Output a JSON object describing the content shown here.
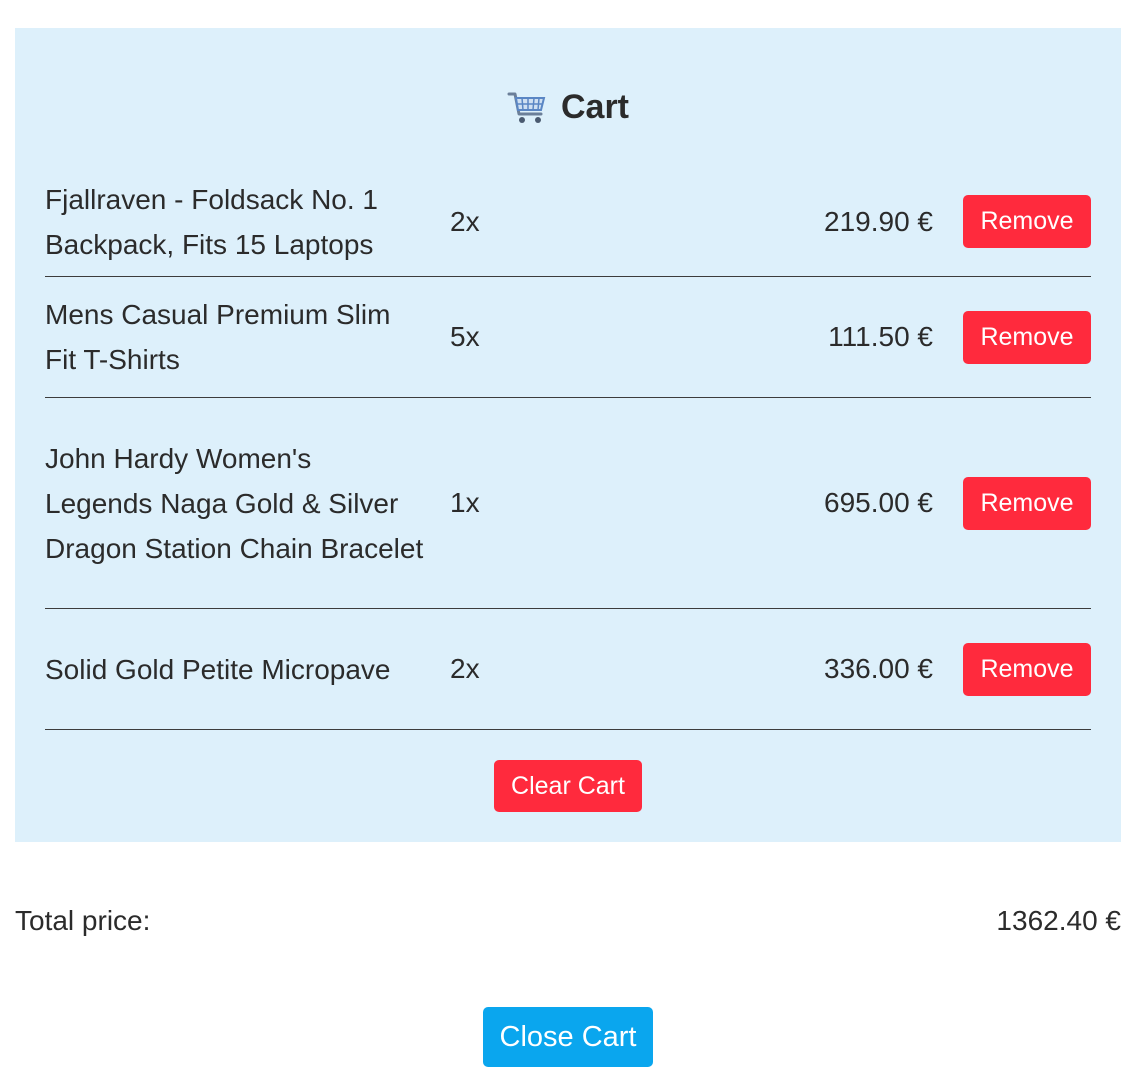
{
  "cart": {
    "icon": "shopping-cart-icon",
    "title": "Cart",
    "items": [
      {
        "name": "Fjallraven - Foldsack No. 1 Backpack, Fits 15 Laptops",
        "qty": "2x",
        "price": "219.90 €",
        "remove_label": "Remove"
      },
      {
        "name": "Mens Casual Premium Slim Fit T-Shirts",
        "qty": "5x",
        "price": "111.50 €",
        "remove_label": "Remove"
      },
      {
        "name": "John Hardy Women's Legends Naga Gold & Silver Dragon Station Chain Bracelet",
        "qty": "1x",
        "price": "695.00 €",
        "remove_label": "Remove"
      },
      {
        "name": "Solid Gold Petite Micropave",
        "qty": "2x",
        "price": "336.00 €",
        "remove_label": "Remove"
      }
    ],
    "clear_label": "Clear Cart"
  },
  "total": {
    "label": "Total price:",
    "value": "1362.40 €"
  },
  "close_label": "Close Cart",
  "colors": {
    "panel_bg": "#ddf0fb",
    "danger": "#ff2a3d",
    "primary": "#0aa6ee",
    "text": "#2b2b2b"
  }
}
